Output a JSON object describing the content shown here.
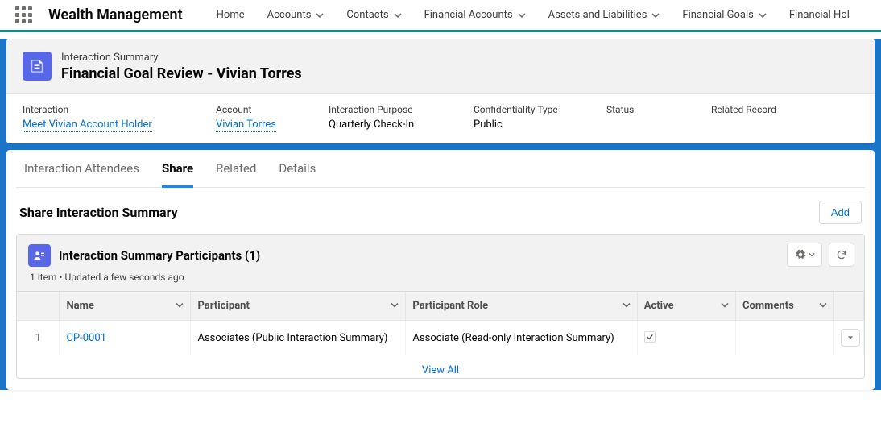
{
  "app": {
    "name": "Wealth Management"
  },
  "nav": [
    {
      "label": "Home",
      "has_menu": false
    },
    {
      "label": "Accounts",
      "has_menu": true
    },
    {
      "label": "Contacts",
      "has_menu": true
    },
    {
      "label": "Financial Accounts",
      "has_menu": true
    },
    {
      "label": "Assets and Liabilities",
      "has_menu": true
    },
    {
      "label": "Financial Goals",
      "has_menu": true
    },
    {
      "label": "Financial Hol",
      "has_menu": false
    }
  ],
  "record": {
    "object_label": "Interaction Summary",
    "title": "Financial Goal Review - Vivian Torres",
    "fields": {
      "interaction": {
        "label": "Interaction",
        "value": "Meet Vivian Account Holder"
      },
      "account": {
        "label": "Account",
        "value": "Vivian Torres"
      },
      "purpose": {
        "label": "Interaction Purpose",
        "value": "Quarterly Check-In"
      },
      "confidentiality": {
        "label": "Confidentiality Type",
        "value": "Public"
      },
      "status": {
        "label": "Status",
        "value": ""
      },
      "related_record": {
        "label": "Related Record",
        "value": ""
      }
    }
  },
  "tabs": {
    "attendees": "Interaction Attendees",
    "share": "Share",
    "related": "Related",
    "details": "Details"
  },
  "share": {
    "title": "Share Interaction Summary",
    "add_label": "Add",
    "participants": {
      "title_base": "Interaction Summary Participants",
      "count": "1",
      "subtitle": "1 item • Updated a few seconds ago",
      "columns": {
        "name": "Name",
        "participant": "Participant",
        "role": "Participant Role",
        "active": "Active",
        "comments": "Comments"
      },
      "rows": [
        {
          "num": "1",
          "name": "CP-0001",
          "participant": "Associates (Public Interaction Summary)",
          "role": "Associate (Read-only Interaction Summary)",
          "active": true,
          "comments": ""
        }
      ],
      "view_all": "View All"
    }
  }
}
